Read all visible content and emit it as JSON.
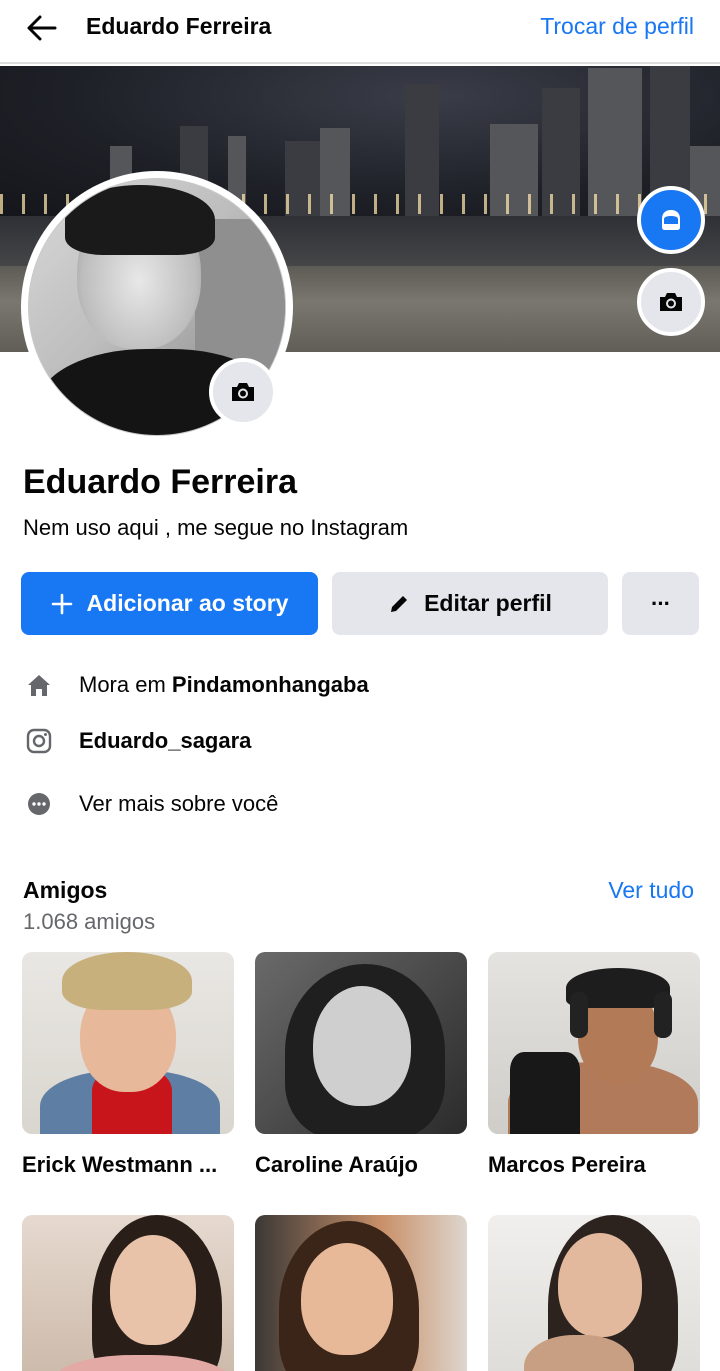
{
  "header": {
    "title": "Eduardo Ferreira",
    "switch_profile": "Trocar de perfil"
  },
  "profile": {
    "name": "Eduardo Ferreira",
    "bio": "Nem uso aqui , me segue no Instagram"
  },
  "actions": {
    "add_story": "Adicionar ao story",
    "edit_profile": "Editar perfil",
    "more": "···"
  },
  "info": {
    "lives_prefix": "Mora em ",
    "lives_city": "Pindamonhangaba",
    "instagram": "Eduardo_sagara",
    "see_more": "Ver mais sobre você"
  },
  "friends": {
    "title": "Amigos",
    "count": "1.068 amigos",
    "see_all": "Ver tudo",
    "items": [
      {
        "name": "Erick Westmann ..."
      },
      {
        "name": "Caroline Araújo"
      },
      {
        "name": "Marcos Pereira"
      },
      {
        "name": ""
      },
      {
        "name": ""
      },
      {
        "name": ""
      }
    ]
  },
  "colors": {
    "accent": "#1877f2",
    "button_gray": "#e4e6eb",
    "muted_text": "#65676b"
  },
  "icons": {
    "back": "arrow-left-icon",
    "avatar": "avatar-icon",
    "camera": "camera-icon",
    "plus": "plus-icon",
    "pencil": "pencil-icon",
    "home": "home-icon",
    "instagram": "instagram-icon",
    "more": "more-dots-icon"
  }
}
